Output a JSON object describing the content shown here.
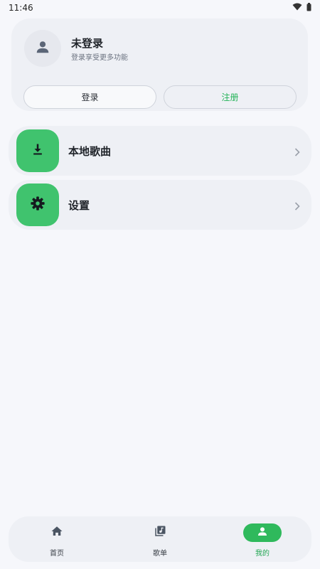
{
  "status_bar": {
    "time": "11:46",
    "icons": [
      "wifi-icon",
      "battery-icon"
    ]
  },
  "profile": {
    "name": "未登录",
    "subtitle": "登录享受更多功能",
    "avatar_icon": "person-icon",
    "login_label": "登录",
    "register_label": "注册"
  },
  "menu": {
    "items": [
      {
        "label": "本地歌曲",
        "icon": "download-icon"
      },
      {
        "label": "设置",
        "icon": "gear-icon"
      }
    ]
  },
  "bottom_nav": {
    "items": [
      {
        "label": "首页",
        "icon": "home-icon",
        "active": false
      },
      {
        "label": "歌单",
        "icon": "playlist-icon",
        "active": false
      },
      {
        "label": "我的",
        "icon": "person-icon",
        "active": true
      }
    ]
  },
  "colors": {
    "accent": "#2fb95c",
    "menu_icon_bg": "#40c36e",
    "card_bg": "#eef0f5",
    "page_bg": "#f6f7fb"
  }
}
